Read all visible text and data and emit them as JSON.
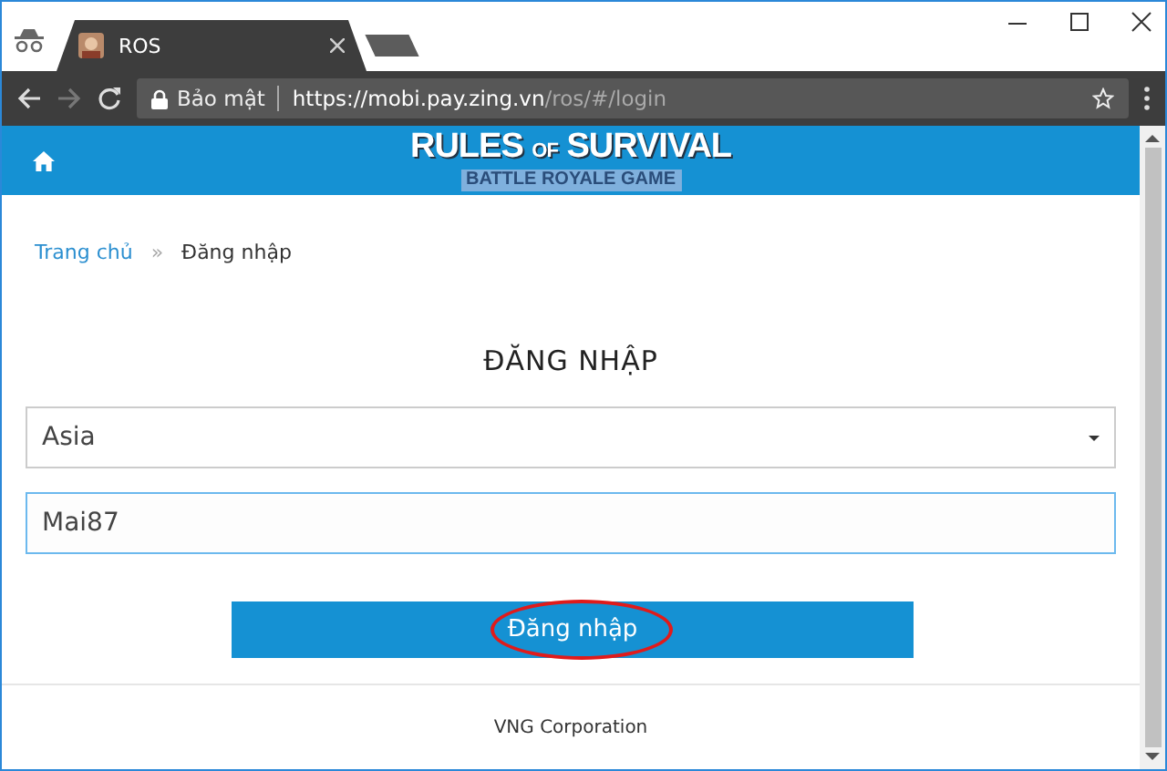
{
  "browser": {
    "incognito": true,
    "tab": {
      "title": "ROS"
    },
    "address": {
      "security_label": "Bảo mật",
      "url_host": "https://mobi.pay.zing.vn",
      "url_path": "/ros/#/login"
    }
  },
  "header": {
    "logo_title": "RULES $_{OF}$ SURVIVAL",
    "logo_subtitle": "BATTLE ROYALE GAME"
  },
  "breadcrumb": [
    {
      "label": "Trang chủ",
      "kind": "link"
    },
    {
      "label": "Đăng nhập",
      "kind": "current"
    }
  ],
  "breadcrumb_separator": "»",
  "login": {
    "heading": "ĐĂNG NHẬP",
    "server_select": {
      "value": "Asia"
    },
    "username": {
      "value": "Mai87",
      "focused": true
    },
    "submit": {
      "label": "Đăng nhập",
      "circled": true
    }
  },
  "footer": {
    "text": "VNG Corporation"
  }
}
